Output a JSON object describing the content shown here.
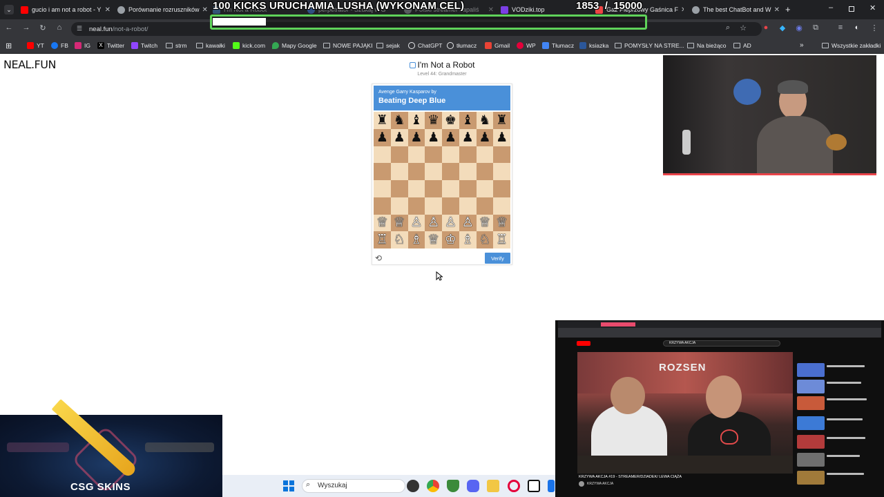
{
  "browser": {
    "tabs": [
      {
        "title": "gucio i am not a robot - Y",
        "color": "#ff0000"
      },
      {
        "title": "Porównanie rozruszników",
        "color": "#9aa0a6"
      },
      {
        "title": "I'm Not a Robot",
        "color": "#4a90d9"
      },
      {
        "title": "perpetrator - Szukaj w G",
        "color": "#4285f4"
      },
      {
        "title": "Polski streamer zapaliś",
        "color": "#9aa0a6"
      },
      {
        "title": "VODziki.top",
        "color": "#7b3fe4"
      },
      {
        "title": "Gaz Pieprzowy Gaśnica F",
        "color": "#e44"
      },
      {
        "title": "The best ChatBot and W",
        "color": "#9aa0a6"
      }
    ],
    "address": {
      "domain": "neal.fun",
      "path": "/not-a-robot/"
    },
    "bookmarks": [
      {
        "label": "YT",
        "icon": "youtube-icon"
      },
      {
        "label": "FB",
        "icon": "facebook-icon"
      },
      {
        "label": "IG",
        "icon": "instagram-icon"
      },
      {
        "label": "Twitter",
        "icon": "x-icon"
      },
      {
        "label": "Twitch",
        "icon": "twitch-icon"
      },
      {
        "label": "strm",
        "icon": "folder-icon"
      },
      {
        "label": "kawałki",
        "icon": "folder-icon"
      },
      {
        "label": "kick.com",
        "icon": "kick-icon"
      },
      {
        "label": "Mapy Google",
        "icon": "maps-icon"
      },
      {
        "label": "NOWE PAJĄKI",
        "icon": "folder-icon"
      },
      {
        "label": "sejak",
        "icon": "folder-icon"
      },
      {
        "label": "ChatGPT",
        "icon": "chatgpt-icon"
      },
      {
        "label": "tłumacz",
        "icon": "chatgpt-icon"
      },
      {
        "label": "Gmail",
        "icon": "gmail-icon"
      },
      {
        "label": "WP",
        "icon": "wp-icon"
      },
      {
        "label": "Tłumacz",
        "icon": "translate-icon"
      },
      {
        "label": "ksiazka",
        "icon": "word-icon"
      },
      {
        "label": "POMYSŁY NA STRE...",
        "icon": "folder-icon"
      },
      {
        "label": "Na bieżąco",
        "icon": "folder-icon"
      },
      {
        "label": "AD",
        "icon": "folder-icon"
      }
    ],
    "all_bookmarks": "Wszystkie zakładki"
  },
  "overlay": {
    "title": "100 KICKS URUCHAMIA LUSHA (WYKONAM CEL)",
    "current": "1853",
    "goal": "15000",
    "progress": 0.1235
  },
  "page": {
    "logo": "NEAL.FUN",
    "title": "I'm Not a Robot",
    "level": "Level 44: Grandmaster",
    "captcha": {
      "subtitle": "Avenge Garry Kasparov by",
      "heading": "Beating Deep Blue",
      "verify_label": "Verify",
      "board": [
        [
          "♜",
          "♞",
          "♝",
          "♛",
          "♚",
          "♝",
          "♞",
          "♜"
        ],
        [
          "♟",
          "♟",
          "♟",
          "♟",
          "♟",
          "♟",
          "♟",
          "♟"
        ],
        [
          "",
          "",
          "",
          "",
          "",
          "",
          "",
          ""
        ],
        [
          "",
          "",
          "",
          "",
          "",
          "",
          "",
          ""
        ],
        [
          "",
          "",
          "",
          "",
          "",
          "",
          "",
          ""
        ],
        [
          "",
          "",
          "",
          "",
          "",
          "",
          "",
          ""
        ],
        [
          "♕",
          "♕",
          "♙",
          "♙",
          "♙",
          "♙",
          "♕",
          "♕"
        ],
        [
          "♖",
          "♘",
          "♗",
          "♕",
          "♔",
          "♗",
          "♘",
          "♖"
        ]
      ],
      "board_colors": [
        "black",
        "black",
        "",
        "",
        "",
        "",
        "white",
        "white"
      ]
    }
  },
  "embedded_video": {
    "search_query": "KRZYWA AKCJA",
    "title": "KRZYWA AKCJA #19 - STREAMER/DZIADEK/ LEWA CIĄŻA",
    "channel": "KRZYWA AKCJA",
    "overlay_text": "ROZSEN"
  },
  "ad": {
    "brand": "CSG SKINS"
  },
  "taskbar": {
    "search_placeholder": "Wyszukaj"
  }
}
